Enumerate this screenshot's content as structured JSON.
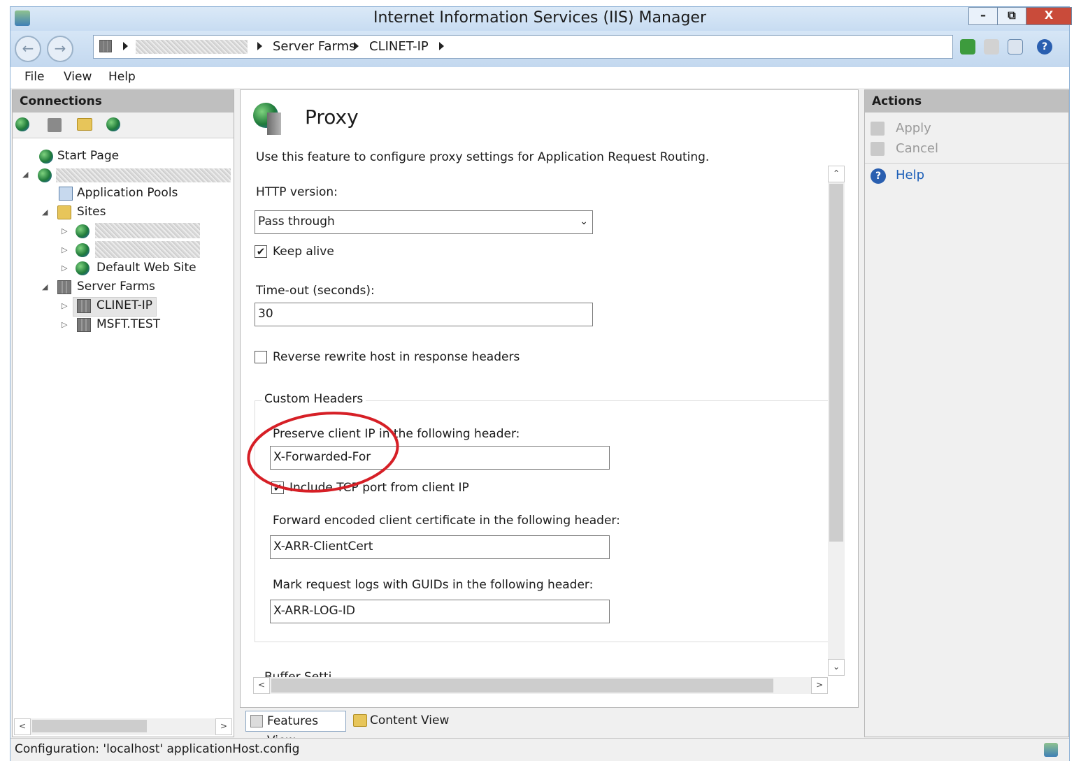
{
  "window": {
    "title": "Internet Information Services (IIS) Manager",
    "controls": {
      "minimize": "–",
      "restore": "⧉",
      "close": "X"
    }
  },
  "address": {
    "crumbs": [
      "Server Farms",
      "CLINET-IP"
    ]
  },
  "menu": {
    "file": "File",
    "view": "View",
    "help": "Help"
  },
  "connections": {
    "header": "Connections",
    "tree": {
      "start_page": "Start Page",
      "app_pools": "Application Pools",
      "sites": "Sites",
      "default_site": "Default Web Site",
      "server_farms": "Server Farms",
      "farm1": "CLINET-IP",
      "farm2": "MSFT.TEST"
    }
  },
  "main": {
    "feature_title": "Proxy",
    "description": "Use this feature to configure proxy settings for Application Request Routing.",
    "http_version_label": "HTTP version:",
    "http_version_value": "Pass through",
    "keep_alive_label": "Keep alive",
    "keep_alive_checked": true,
    "timeout_label": "Time-out (seconds):",
    "timeout_value": "30",
    "reverse_rewrite_label": "Reverse rewrite host in response headers",
    "reverse_rewrite_checked": false,
    "custom_headers_title": "Custom Headers",
    "preserve_ip_label": "Preserve client IP in the following header:",
    "preserve_ip_value": "X-Forwarded-For",
    "include_tcp_label": "Include TCP port from client IP",
    "include_tcp_checked": true,
    "forward_cert_label": "Forward encoded client certificate in the following header:",
    "forward_cert_value": "X-ARR-ClientCert",
    "guid_label": "Mark request logs with GUIDs in the following header:",
    "guid_value": "X-ARR-LOG-ID",
    "buffer_settings_partial": "Buffer Setti"
  },
  "tabs": {
    "features_view": "Features View",
    "content_view": "Content View"
  },
  "actions": {
    "header": "Actions",
    "apply": "Apply",
    "cancel": "Cancel",
    "help": "Help"
  },
  "status": {
    "text": "Configuration: 'localhost' applicationHost.config"
  },
  "colors": {
    "annotation_circle": "#d61f26",
    "help_link": "#1d5fb8",
    "disabled_text": "#9a9a9a"
  }
}
